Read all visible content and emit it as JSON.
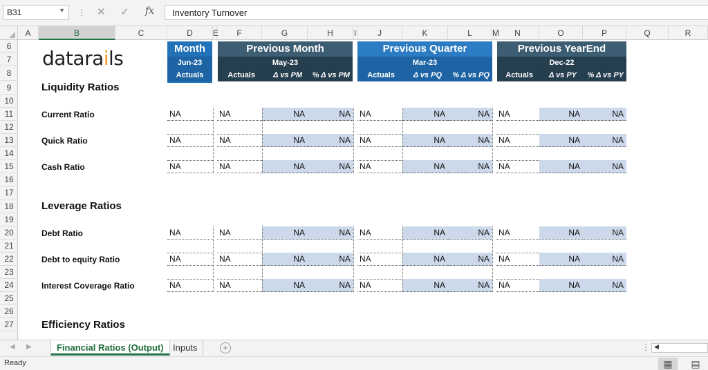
{
  "formula_bar": {
    "name_box": "B31",
    "cancel_icon": "✕",
    "enter_icon": "✓",
    "fx_label": "fx",
    "formula": "Inventory Turnover"
  },
  "columns": [
    "A",
    "B",
    "C",
    "D",
    "E",
    "F",
    "G",
    "H",
    "I",
    "J",
    "K",
    "L",
    "M",
    "N",
    "O",
    "P",
    "Q",
    "R"
  ],
  "selected_column": "B",
  "rows": [
    "6",
    "7",
    "8",
    "9",
    "10",
    "11",
    "12",
    "13",
    "14",
    "15",
    "16",
    "17",
    "18",
    "19",
    "20",
    "21",
    "22",
    "23",
    "24",
    "25",
    "26",
    "27"
  ],
  "logo": {
    "text_pre": "datara",
    "dot": "i",
    "text_post": "ls"
  },
  "headers": {
    "month": {
      "title": "Month",
      "period": "Jun-23",
      "col": "Actuals",
      "color": "#2272b8"
    },
    "prev_month": {
      "title": "Previous Month",
      "period": "May-23",
      "cols": [
        "Actuals",
        "Δ vs PM",
        "% Δ vs PM"
      ],
      "color": "#2e4f63"
    },
    "prev_quarter": {
      "title": "Previous Quarter",
      "period": "Mar-23",
      "cols": [
        "Actuals",
        "Δ vs PQ",
        "% Δ vs PQ"
      ],
      "color": "#2272b8"
    },
    "prev_yearend": {
      "title": "Previous YearEnd",
      "period": "Dec-22",
      "cols": [
        "Actuals",
        "Δ vs PY",
        "% Δ vs PY"
      ],
      "color": "#2e4f63"
    }
  },
  "sections": [
    {
      "title": "Liquidity Ratios",
      "items": [
        "Current Ratio",
        "Quick Ratio",
        "Cash Ratio"
      ]
    },
    {
      "title": "Leverage Ratios",
      "items": [
        "Debt Ratio",
        "Debt to equity Ratio",
        "Interest Coverage Ratio"
      ]
    },
    {
      "title": "Efficiency Ratios",
      "items": []
    }
  ],
  "cell_value": "NA",
  "tabs": [
    {
      "label": "Financial Ratios (Output)",
      "active": true
    },
    {
      "label": "Inputs",
      "active": false
    }
  ],
  "status": {
    "text": "Ready"
  }
}
